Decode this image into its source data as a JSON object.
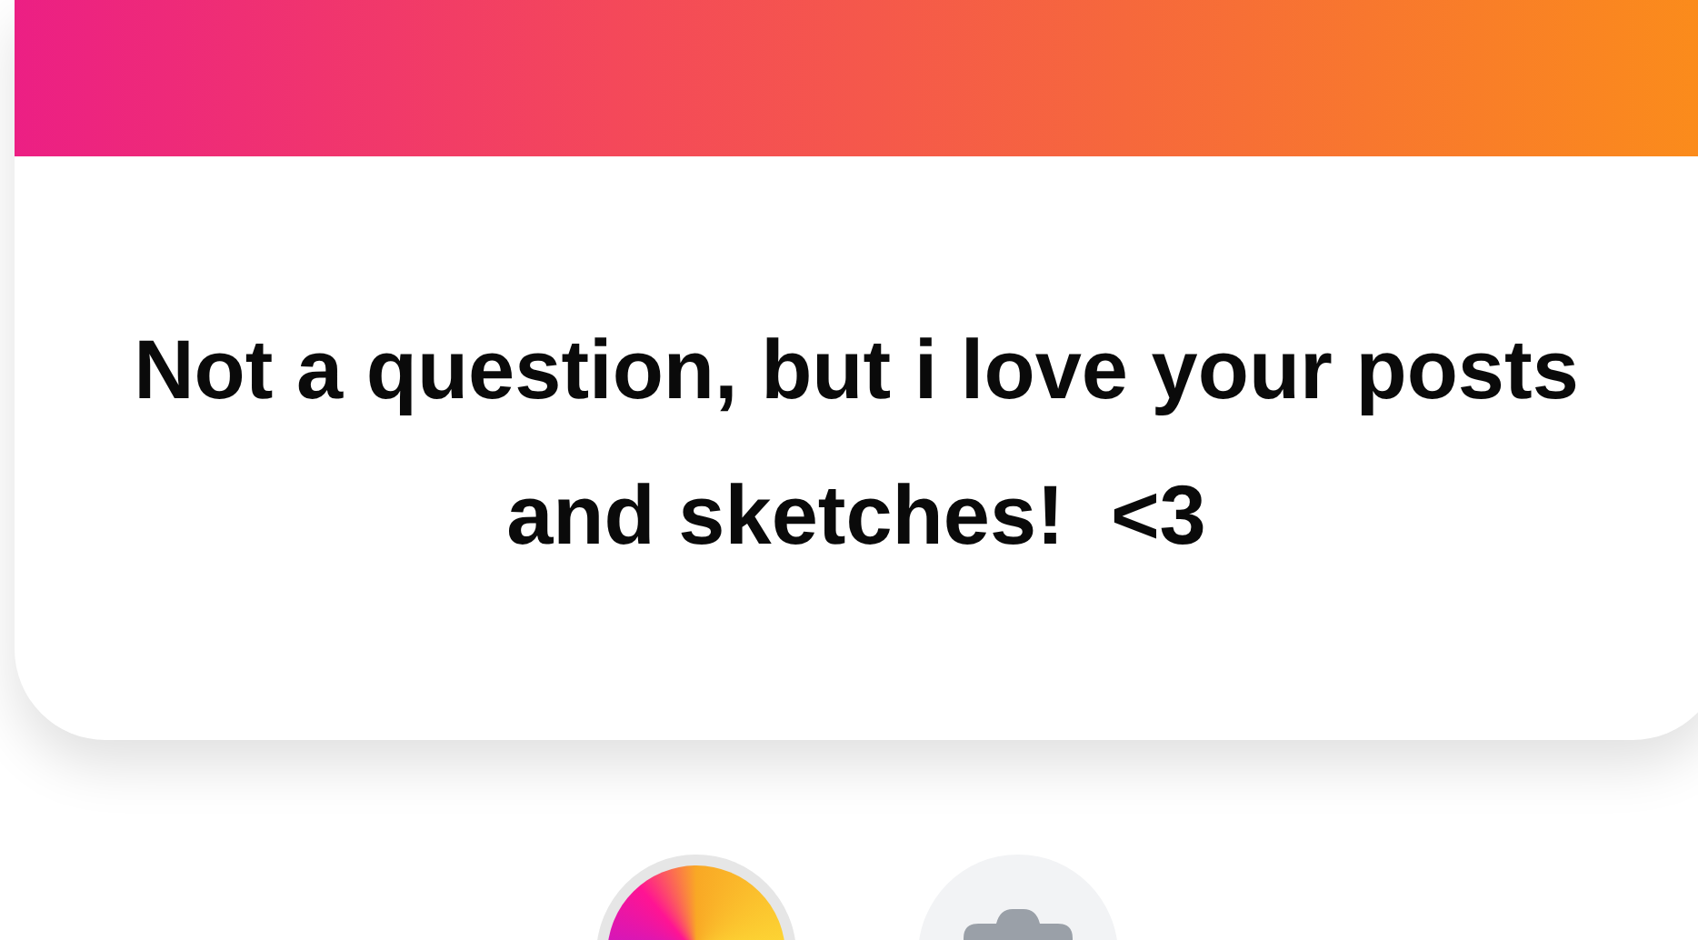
{
  "card": {
    "message": "Not a question, but i love your posts and sketches!  <3"
  }
}
